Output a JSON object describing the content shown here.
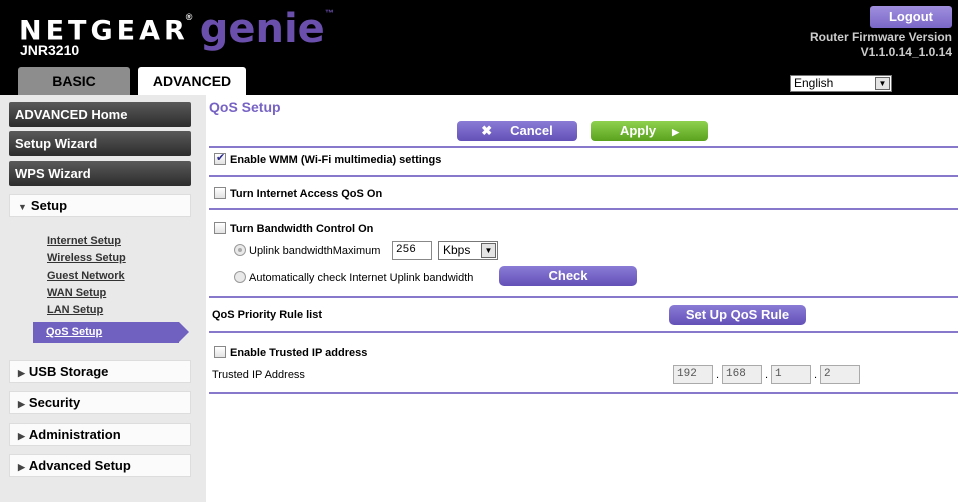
{
  "header": {
    "brand": "NETGEAR",
    "reg": "®",
    "product": "genie",
    "tm": "™",
    "model": "JNR3210",
    "logout": "Logout",
    "fw_label": "Router Firmware Version",
    "fw_version": "V1.1.0.14_1.0.14",
    "tabs": [
      "BASIC",
      "ADVANCED"
    ],
    "language": "English"
  },
  "sidebar": {
    "top_items": [
      "ADVANCED Home",
      "Setup Wizard",
      "WPS Wizard"
    ],
    "setup_label": "Setup",
    "setup_items": [
      "Internet Setup",
      "Wireless Setup",
      "Guest Network",
      "WAN Setup",
      "LAN Setup"
    ],
    "active_item": "QoS Setup",
    "sections": [
      "USB Storage",
      "Security",
      "Administration",
      "Advanced Setup"
    ]
  },
  "main": {
    "title": "QoS Setup",
    "cancel": "Cancel",
    "apply": "Apply",
    "wmm_label": "Enable WMM (Wi-Fi multimedia) settings",
    "wmm_checked": true,
    "qos_on_label": "Turn Internet Access QoS On",
    "bw_label": "Turn Bandwidth Control On",
    "uplink_label": "Uplink bandwidthMaximum",
    "uplink_value": "256",
    "uplink_unit": "Kbps",
    "auto_label": "Automatically check Internet Uplink bandwidth",
    "check": "Check",
    "rule_list_label": "QoS Priority Rule list",
    "setup_rule": "Set Up QoS Rule",
    "trusted_enable_label": "Enable Trusted IP address",
    "trusted_ip_label": "Trusted IP Address",
    "ip": [
      "192",
      "168",
      "1",
      "2"
    ],
    "ip_dot": "."
  },
  "colors": {
    "accent": "#7763c4",
    "apply_green": "#6cb52f",
    "header_bg": "#000000"
  }
}
